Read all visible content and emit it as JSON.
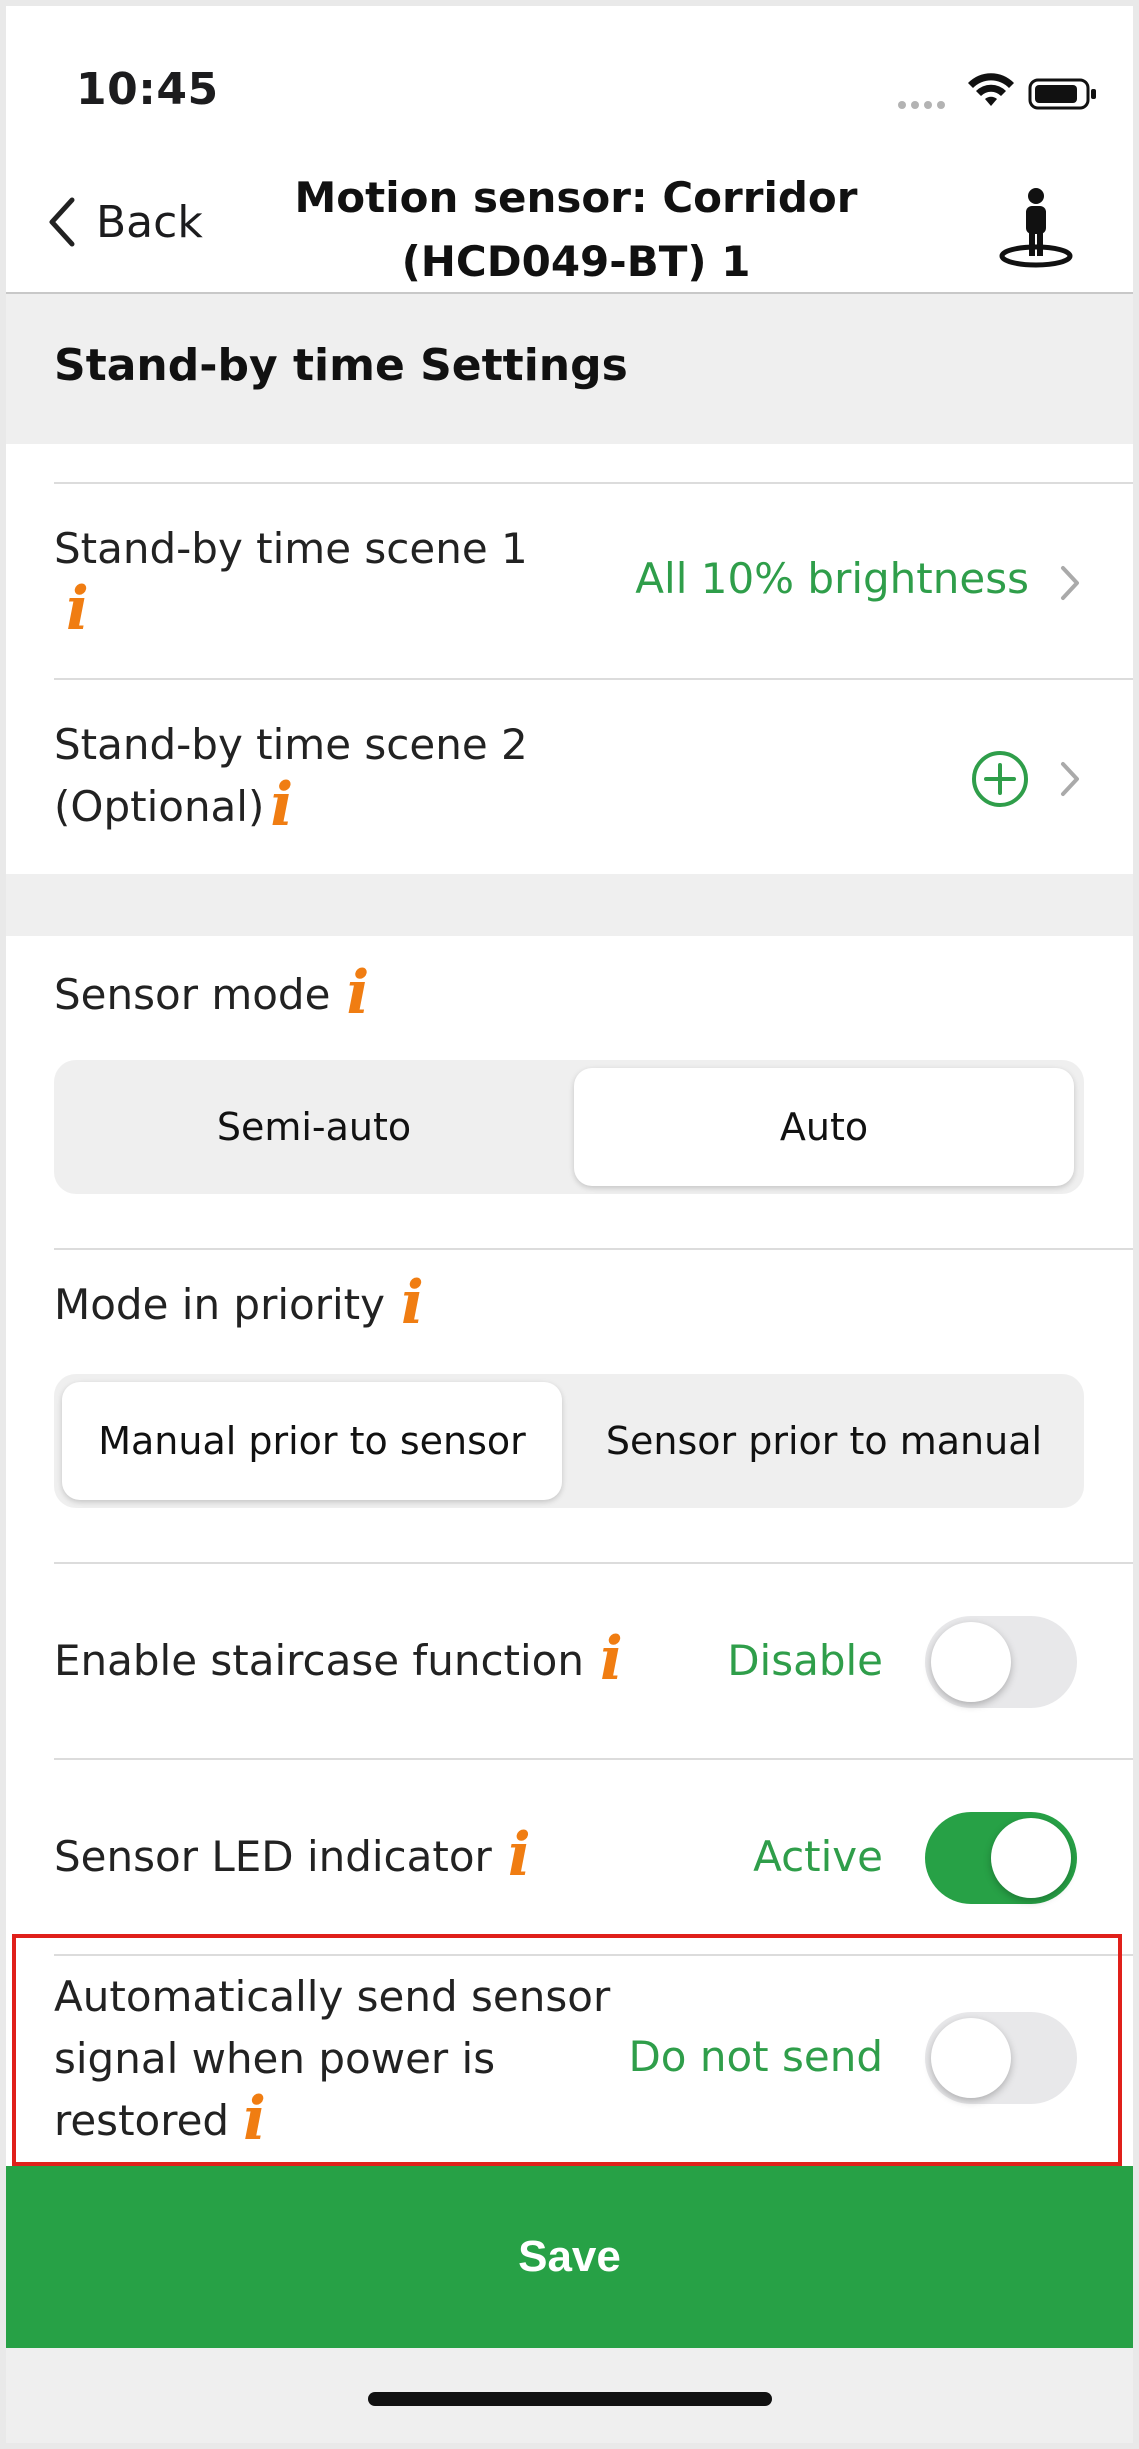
{
  "status_bar": {
    "time": "10:45"
  },
  "nav": {
    "back_label": "Back",
    "title_line1": "Motion sensor: Corridor",
    "title_line2": "(HCD049-BT) 1",
    "right_icon": "person-standing-icon"
  },
  "section": {
    "title": "Stand-by time Settings"
  },
  "standby_scene_1": {
    "label": "Stand-by time scene 1",
    "value": "All 10% brightness"
  },
  "standby_scene_2": {
    "label_line1": "Stand-by time scene 2",
    "label_line2": "(Optional)"
  },
  "sensor_mode": {
    "label": "Sensor mode",
    "options": [
      "Semi-auto",
      "Auto"
    ],
    "selected": "Auto"
  },
  "mode_priority": {
    "label": "Mode in priority",
    "options": [
      "Manual prior to sensor",
      "Sensor prior to manual"
    ],
    "selected": "Manual prior to sensor"
  },
  "staircase": {
    "label": "Enable staircase function",
    "value": "Disable",
    "on": false
  },
  "led_indicator": {
    "label": "Sensor LED indicator",
    "value": "Active",
    "on": true
  },
  "auto_send": {
    "label_line1": "Automatically send sensor",
    "label_line2": "signal when power is",
    "label_line3": "restored",
    "value": "Do not send",
    "on": false
  },
  "info_glyph": "i",
  "save_label": "Save",
  "colors": {
    "accent_green": "#27a146",
    "value_green": "#2f9e4a",
    "info_orange": "#f07d12",
    "highlight_red": "#e0201a"
  }
}
